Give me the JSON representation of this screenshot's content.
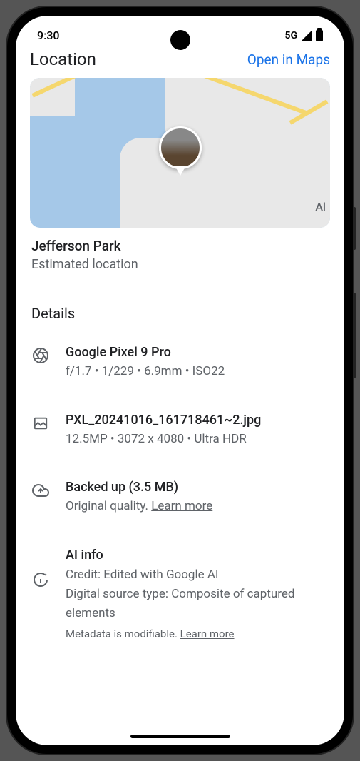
{
  "status": {
    "time": "9:30",
    "network": "5G"
  },
  "header": {
    "title": "Location",
    "action": "Open in Maps"
  },
  "map": {
    "label_fragment": "Al"
  },
  "location": {
    "name": "Jefferson Park",
    "subtitle": "Estimated location"
  },
  "details": {
    "section_title": "Details",
    "device": {
      "name": "Google Pixel 9 Pro",
      "specs": "f/1.7  •  1/229  •  6.9mm  •  ISO22"
    },
    "file": {
      "name": "PXL_20241016_161718461~2.jpg",
      "specs": "12.5MP  •  3072 x 4080  • Ultra HDR"
    },
    "backup": {
      "title": "Backed up (3.5 MB)",
      "quality": "Original quality. ",
      "learn_more": "Learn more"
    },
    "ai": {
      "title": "AI info",
      "credit": "Credit: Edited with Google AI",
      "source": "Digital source type: Composite of captured elements",
      "meta_prefix": "Metadata is modifiable. ",
      "learn_more": "Learn more"
    }
  }
}
